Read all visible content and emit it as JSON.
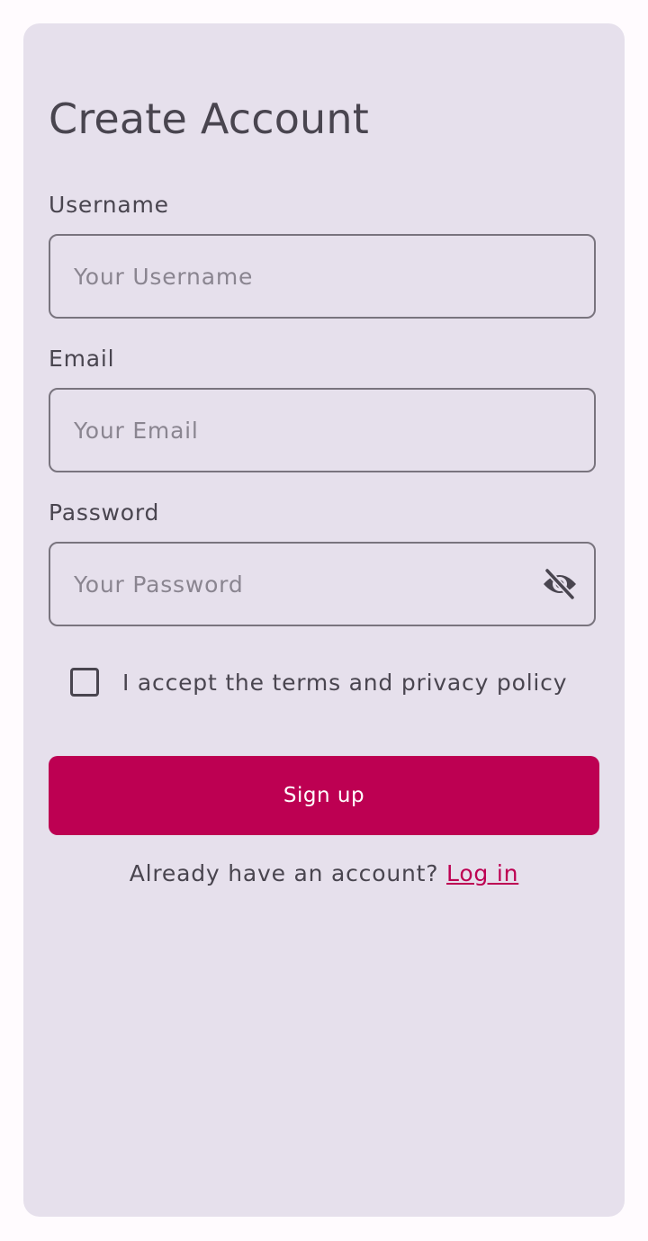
{
  "form": {
    "title": "Create Account",
    "username": {
      "label": "Username",
      "value": "",
      "placeholder": "Your Username"
    },
    "email": {
      "label": "Email",
      "value": "",
      "placeholder": "Your Email"
    },
    "password": {
      "label": "Password",
      "value": "",
      "placeholder": "Your Password",
      "visibility_icon": "eye-off-icon"
    },
    "terms": {
      "checked": false,
      "label": "I accept the terms and privacy policy"
    },
    "signup_label": "Sign up",
    "footer_text": "Already have an account?",
    "login_link": "Log in"
  },
  "colors": {
    "background": "#fffbfe",
    "card": "#e6e0ec",
    "primary": "#bd0052",
    "text": "#49454f",
    "outline": "#79747e"
  }
}
